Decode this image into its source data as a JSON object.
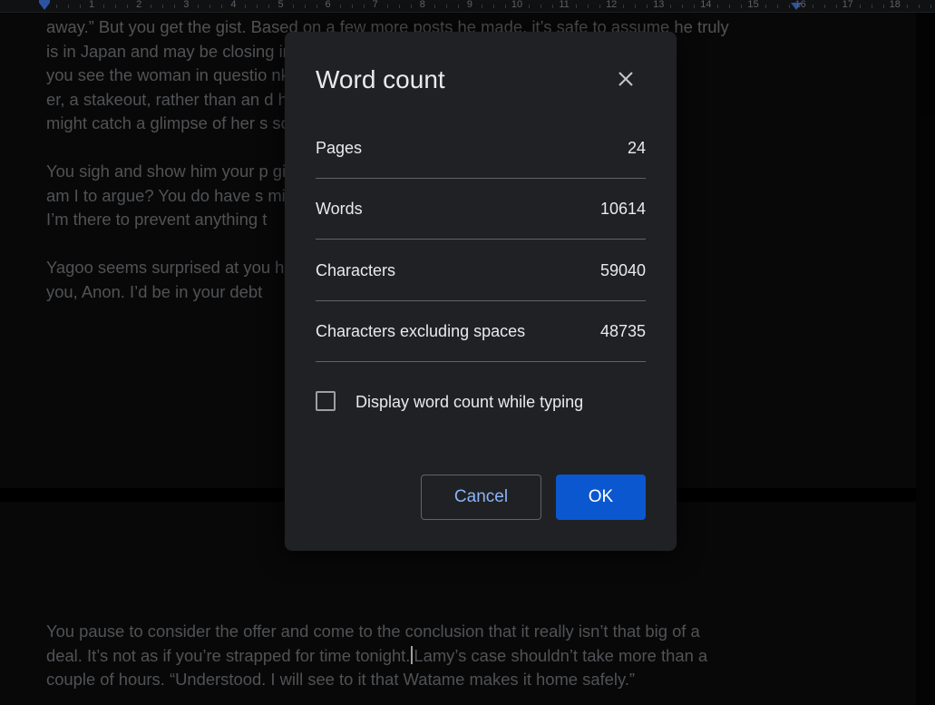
{
  "ruler": {
    "numbers": [
      "1",
      "2",
      "3",
      "4",
      "5",
      "6",
      "7",
      "8",
      "9",
      "10",
      "11",
      "12",
      "13",
      "14",
      "15",
      "16",
      "17",
      "18"
    ]
  },
  "document": {
    "page1_text": "away.” But you get the gist. Based on a few more posts he made, it’s safe to assume he truly\nis in Japan and may be closing                                                                        ing’s exit and\nyou see the woman in questio                                                                       nk of it like a…\ner, a stakeout, rather than an                                                                        d her you\nmight catch a glimpse of her s                                                                       so…”\n\nYou sigh and show him your p                                                                     gic, but who\nam I to argue? You do have s                                                                     mind at ease if\nI’m there to prevent anything t\n\nYagoo seems surprised at you                                                                       helpful of\nyou, Anon. I’d be in your debt",
    "page2_before_caret": "You pause to consider the offer and come to the conclusion that it really isn’t that big of a\ndeal. It’s not as if you’re strapped for time tonight.",
    "page2_after_caret": "Lamy’s case shouldn’t take more than a\ncouple of hours. “Understood. I will see to it that Watame makes it home safely.”"
  },
  "dialog": {
    "title": "Word count",
    "close_icon": "close-icon",
    "stats": [
      {
        "label": "Pages",
        "value": "24"
      },
      {
        "label": "Words",
        "value": "10614"
      },
      {
        "label": "Characters",
        "value": "59040"
      },
      {
        "label": "Characters excluding spaces",
        "value": "48735"
      }
    ],
    "checkbox_label": "Display word count while typing",
    "checkbox_checked": false,
    "cancel_label": "Cancel",
    "ok_label": "OK"
  },
  "colors": {
    "dialog_bg": "#202124",
    "primary_button": "#0b57d0",
    "link_text": "#8ab4f8",
    "doc_text": "#6b6e72"
  }
}
